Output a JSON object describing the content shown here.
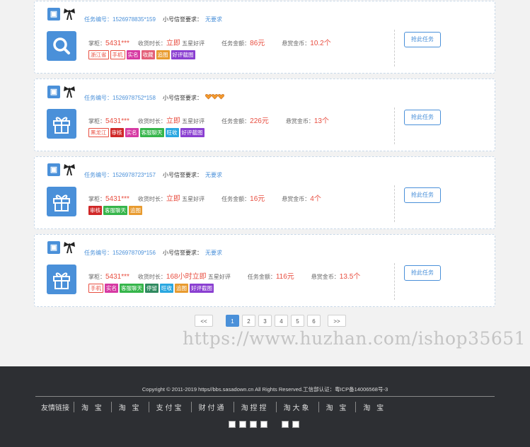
{
  "tasks": [
    {
      "task_no": "任务编号：1526978835*159",
      "req_label": "小号信誉要求：",
      "req_value": "无要求",
      "req_hearts": false,
      "icon": "search-icon",
      "shopkeeper_label": "掌柜：",
      "shopkeeper": "5431***",
      "duration_label": "收货时长：",
      "duration": "立即",
      "rating": "五星好评",
      "amount_label": "任务金额：",
      "amount": "86元",
      "reward_label": "悬赏金币：",
      "reward": "10.2个",
      "tags": [
        {
          "text": "浙江省",
          "color": "#ffffff",
          "outline": true
        },
        {
          "text": "手机",
          "color": "#ffffff",
          "outline": true
        },
        {
          "text": "实名",
          "color": "#d63aa3",
          "outline": false
        },
        {
          "text": "收藏",
          "color": "#e35f78",
          "outline": false
        },
        {
          "text": "追图",
          "color": "#e89b2f",
          "outline": false
        },
        {
          "text": "好评截图",
          "color": "#8a3fd1",
          "outline": false
        }
      ],
      "button": "抢此任务"
    },
    {
      "task_no": "任务编号：1526978752*158",
      "req_label": "小号信誉要求：",
      "req_value": "",
      "req_hearts": true,
      "icon": "gift-icon",
      "shopkeeper_label": "掌柜：",
      "shopkeeper": "5431***",
      "duration_label": "收货时长：",
      "duration": "立即",
      "rating": "五星好评",
      "amount_label": "任务金额：",
      "amount": "226元",
      "reward_label": "悬赏金币：",
      "reward": "13个",
      "tags": [
        {
          "text": "黑龙江",
          "color": "#ffffff",
          "outline": true
        },
        {
          "text": "审核",
          "color": "#d02828",
          "outline": false
        },
        {
          "text": "实名",
          "color": "#d63aa3",
          "outline": false
        },
        {
          "text": "客服聊天",
          "color": "#35b54a",
          "outline": false
        },
        {
          "text": "旺收",
          "color": "#2aa7e0",
          "outline": false
        },
        {
          "text": "好评截图",
          "color": "#8a3fd1",
          "outline": false
        }
      ],
      "button": "抢此任务"
    },
    {
      "task_no": "任务编号：1526978723*157",
      "req_label": "小号信誉要求：",
      "req_value": "无要求",
      "req_hearts": false,
      "icon": "gift-icon",
      "shopkeeper_label": "掌柜：",
      "shopkeeper": "5431***",
      "duration_label": "收货时长：",
      "duration": "立即",
      "rating": "五星好评",
      "amount_label": "任务金额：",
      "amount": "16元",
      "reward_label": "悬赏金币：",
      "reward": "4个",
      "tags": [
        {
          "text": "审核",
          "color": "#d02828",
          "outline": false
        },
        {
          "text": "客服聊天",
          "color": "#35b54a",
          "outline": false
        },
        {
          "text": "追图",
          "color": "#e89b2f",
          "outline": false
        }
      ],
      "button": "抢此任务"
    },
    {
      "task_no": "任务编号：1526978709*156",
      "req_label": "小号信誉要求：",
      "req_value": "无要求",
      "req_hearts": false,
      "icon": "gift-icon",
      "shopkeeper_label": "掌柜：",
      "shopkeeper": "5431***",
      "duration_label": "收货时长：",
      "duration": "168小时立即",
      "rating": "五星好评",
      "amount_label": "任务金额：",
      "amount": "116元",
      "reward_label": "悬赏金币：",
      "reward": "13.5个",
      "tags": [
        {
          "text": "手机",
          "color": "#ffffff",
          "outline": true
        },
        {
          "text": "实名",
          "color": "#d63aa3",
          "outline": false
        },
        {
          "text": "客服聊天",
          "color": "#35b54a",
          "outline": false
        },
        {
          "text": "停留",
          "color": "#2f8a5f",
          "outline": false
        },
        {
          "text": "旺收",
          "color": "#2aa7e0",
          "outline": false
        },
        {
          "text": "追图",
          "color": "#e89b2f",
          "outline": false
        },
        {
          "text": "好评截图",
          "color": "#8a3fd1",
          "outline": false
        }
      ],
      "button": "抢此任务"
    }
  ],
  "pagination": [
    "<<",
    "1",
    "2",
    "3",
    "4",
    "5",
    "6",
    ">>"
  ],
  "pagination_active": "1",
  "watermark": "https://www.huzhan.com/ishop35651",
  "footer": {
    "copyright": "Copyright © 2011-2019 https//bbs.sasadown.cn All Rights Reserved.工信部认证：粤ICP备14006568号-3",
    "links_label": "友情链接",
    "links": [
      "淘 宝",
      "淘 宝",
      "支付宝",
      "财付通",
      "淘捏捏",
      "淘大象",
      "淘 宝",
      "淘 宝"
    ],
    "image_count": 6
  },
  "colors": {
    "accent": "#4a90d9",
    "price": "#e84e40",
    "footer_bg": "#2d2f33"
  }
}
